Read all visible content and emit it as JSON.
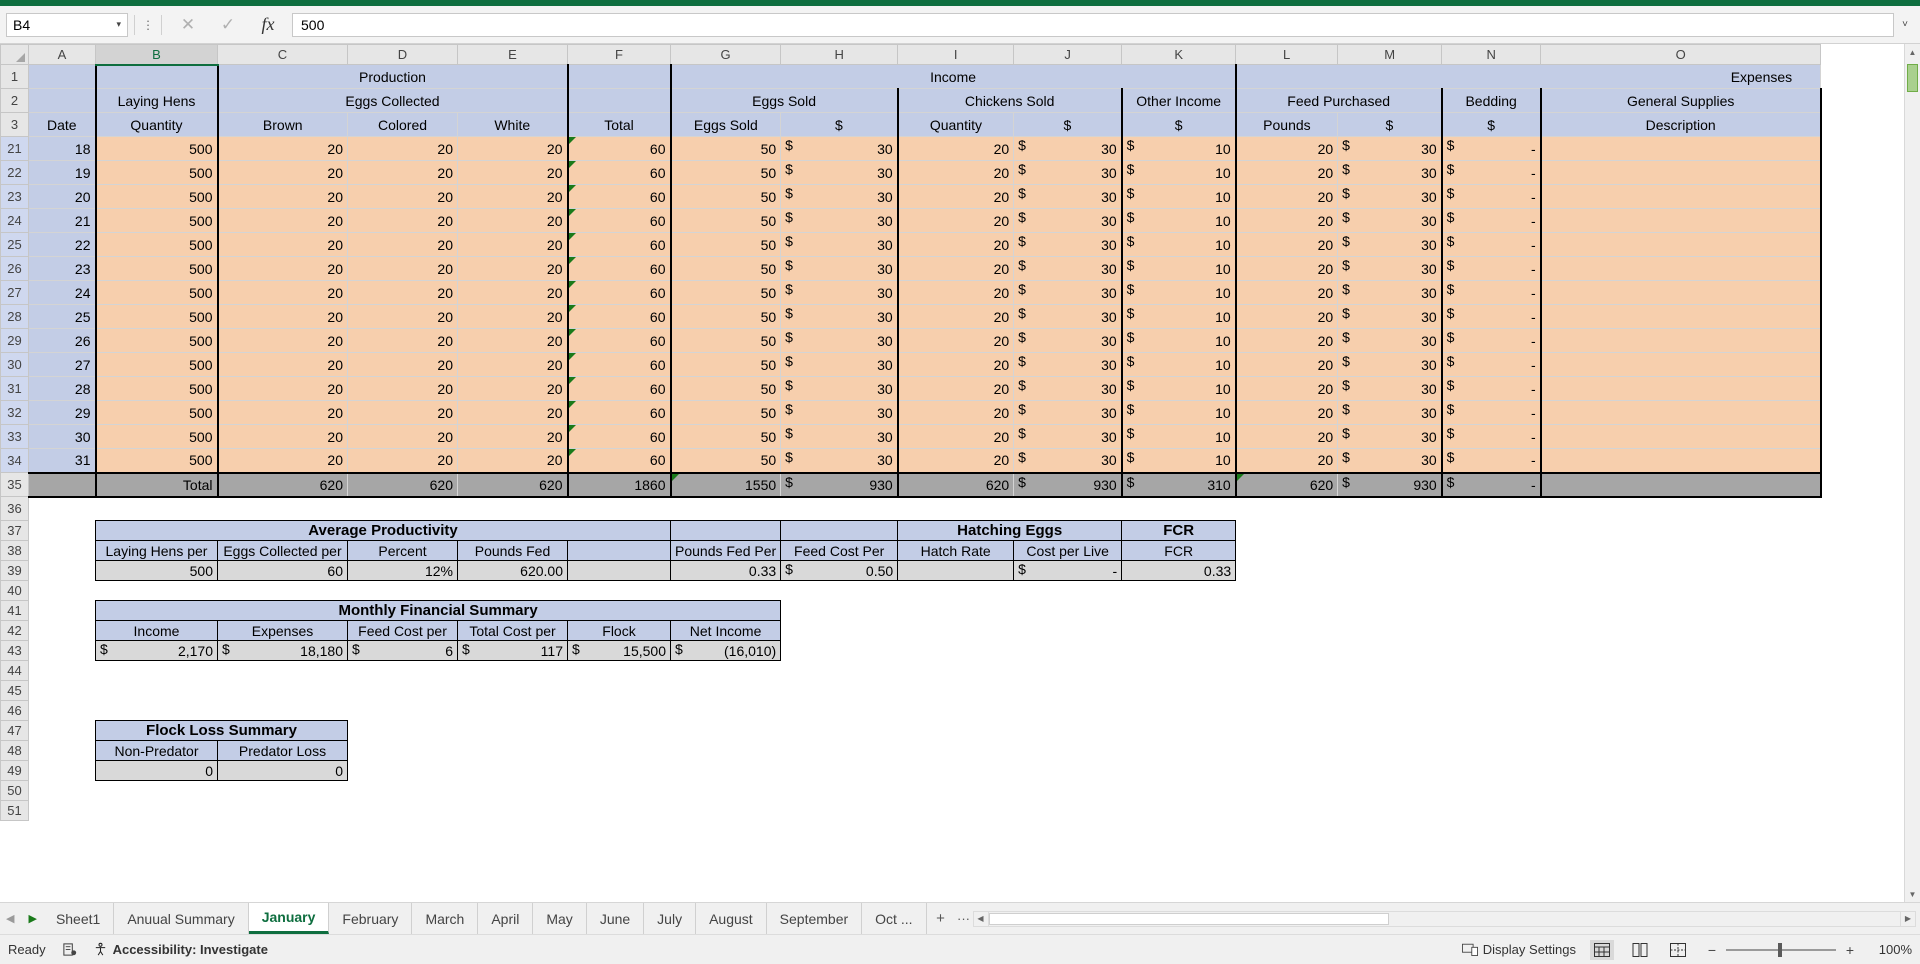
{
  "formula_bar": {
    "name_box": "B4",
    "name_box_caret": "▾",
    "cancel_icon": "✕",
    "enter_icon": "✓",
    "fx_icon": "fx",
    "formula_value": "500",
    "expand_icon": "˅"
  },
  "grid": {
    "selected_column": "B",
    "column_letters": [
      "A",
      "B",
      "C",
      "D",
      "E",
      "F",
      "G",
      "H",
      "I",
      "J",
      "K",
      "L",
      "M",
      "N",
      "O"
    ],
    "row_numbers": [
      "1",
      "2",
      "3",
      "21",
      "22",
      "23",
      "24",
      "25",
      "26",
      "27",
      "28",
      "29",
      "30",
      "31",
      "32",
      "33",
      "34",
      "35",
      "36",
      "37",
      "38",
      "39",
      "40",
      "41",
      "42",
      "43",
      "44",
      "45",
      "46",
      "47",
      "48",
      "49",
      "50",
      "51"
    ],
    "group_headers": {
      "production": "Production",
      "income": "Income",
      "expenses": "Expenses"
    },
    "sub_headers": {
      "laying_hens": "Laying Hens",
      "eggs_collected": "Eggs Collected",
      "eggs_sold": "Eggs Sold",
      "chickens_sold": "Chickens Sold",
      "other_income": "Other Income",
      "feed_purchased": "Feed Purchased",
      "bedding": "Bedding",
      "general_supplies": "General Supplies"
    },
    "field_headers": {
      "date": "Date",
      "quantity": "Quantity",
      "brown": "Brown",
      "colored": "Colored",
      "white": "White",
      "total": "Total",
      "eggs_sold": "Eggs Sold",
      "dollar": "$",
      "chicken_qty": "Quantity",
      "chicken_dollar": "$",
      "other_dollar": "$",
      "pounds": "Pounds",
      "feed_dollar": "$",
      "bedding_dollar": "$",
      "description": "Description"
    },
    "rows": [
      {
        "r": "21",
        "date": "18",
        "qty": "500",
        "brown": "20",
        "colored": "20",
        "white": "20",
        "total": "60",
        "eggs_sold": "50",
        "eggs_amt": "30",
        "chick_qty": "20",
        "chick_amt": "30",
        "other_amt": "10",
        "pounds": "20",
        "feed_amt": "30",
        "bedding_amt": "-",
        "desc": ""
      },
      {
        "r": "22",
        "date": "19",
        "qty": "500",
        "brown": "20",
        "colored": "20",
        "white": "20",
        "total": "60",
        "eggs_sold": "50",
        "eggs_amt": "30",
        "chick_qty": "20",
        "chick_amt": "30",
        "other_amt": "10",
        "pounds": "20",
        "feed_amt": "30",
        "bedding_amt": "-",
        "desc": ""
      },
      {
        "r": "23",
        "date": "20",
        "qty": "500",
        "brown": "20",
        "colored": "20",
        "white": "20",
        "total": "60",
        "eggs_sold": "50",
        "eggs_amt": "30",
        "chick_qty": "20",
        "chick_amt": "30",
        "other_amt": "10",
        "pounds": "20",
        "feed_amt": "30",
        "bedding_amt": "-",
        "desc": ""
      },
      {
        "r": "24",
        "date": "21",
        "qty": "500",
        "brown": "20",
        "colored": "20",
        "white": "20",
        "total": "60",
        "eggs_sold": "50",
        "eggs_amt": "30",
        "chick_qty": "20",
        "chick_amt": "30",
        "other_amt": "10",
        "pounds": "20",
        "feed_amt": "30",
        "bedding_amt": "-",
        "desc": ""
      },
      {
        "r": "25",
        "date": "22",
        "qty": "500",
        "brown": "20",
        "colored": "20",
        "white": "20",
        "total": "60",
        "eggs_sold": "50",
        "eggs_amt": "30",
        "chick_qty": "20",
        "chick_amt": "30",
        "other_amt": "10",
        "pounds": "20",
        "feed_amt": "30",
        "bedding_amt": "-",
        "desc": ""
      },
      {
        "r": "26",
        "date": "23",
        "qty": "500",
        "brown": "20",
        "colored": "20",
        "white": "20",
        "total": "60",
        "eggs_sold": "50",
        "eggs_amt": "30",
        "chick_qty": "20",
        "chick_amt": "30",
        "other_amt": "10",
        "pounds": "20",
        "feed_amt": "30",
        "bedding_amt": "-",
        "desc": ""
      },
      {
        "r": "27",
        "date": "24",
        "qty": "500",
        "brown": "20",
        "colored": "20",
        "white": "20",
        "total": "60",
        "eggs_sold": "50",
        "eggs_amt": "30",
        "chick_qty": "20",
        "chick_amt": "30",
        "other_amt": "10",
        "pounds": "20",
        "feed_amt": "30",
        "bedding_amt": "-",
        "desc": ""
      },
      {
        "r": "28",
        "date": "25",
        "qty": "500",
        "brown": "20",
        "colored": "20",
        "white": "20",
        "total": "60",
        "eggs_sold": "50",
        "eggs_amt": "30",
        "chick_qty": "20",
        "chick_amt": "30",
        "other_amt": "10",
        "pounds": "20",
        "feed_amt": "30",
        "bedding_amt": "-",
        "desc": ""
      },
      {
        "r": "29",
        "date": "26",
        "qty": "500",
        "brown": "20",
        "colored": "20",
        "white": "20",
        "total": "60",
        "eggs_sold": "50",
        "eggs_amt": "30",
        "chick_qty": "20",
        "chick_amt": "30",
        "other_amt": "10",
        "pounds": "20",
        "feed_amt": "30",
        "bedding_amt": "-",
        "desc": ""
      },
      {
        "r": "30",
        "date": "27",
        "qty": "500",
        "brown": "20",
        "colored": "20",
        "white": "20",
        "total": "60",
        "eggs_sold": "50",
        "eggs_amt": "30",
        "chick_qty": "20",
        "chick_amt": "30",
        "other_amt": "10",
        "pounds": "20",
        "feed_amt": "30",
        "bedding_amt": "-",
        "desc": ""
      },
      {
        "r": "31",
        "date": "28",
        "qty": "500",
        "brown": "20",
        "colored": "20",
        "white": "20",
        "total": "60",
        "eggs_sold": "50",
        "eggs_amt": "30",
        "chick_qty": "20",
        "chick_amt": "30",
        "other_amt": "10",
        "pounds": "20",
        "feed_amt": "30",
        "bedding_amt": "-",
        "desc": ""
      },
      {
        "r": "32",
        "date": "29",
        "qty": "500",
        "brown": "20",
        "colored": "20",
        "white": "20",
        "total": "60",
        "eggs_sold": "50",
        "eggs_amt": "30",
        "chick_qty": "20",
        "chick_amt": "30",
        "other_amt": "10",
        "pounds": "20",
        "feed_amt": "30",
        "bedding_amt": "-",
        "desc": ""
      },
      {
        "r": "33",
        "date": "30",
        "qty": "500",
        "brown": "20",
        "colored": "20",
        "white": "20",
        "total": "60",
        "eggs_sold": "50",
        "eggs_amt": "30",
        "chick_qty": "20",
        "chick_amt": "30",
        "other_amt": "10",
        "pounds": "20",
        "feed_amt": "30",
        "bedding_amt": "-",
        "desc": ""
      },
      {
        "r": "34",
        "date": "31",
        "qty": "500",
        "brown": "20",
        "colored": "20",
        "white": "20",
        "total": "60",
        "eggs_sold": "50",
        "eggs_amt": "30",
        "chick_qty": "20",
        "chick_amt": "30",
        "other_amt": "10",
        "pounds": "20",
        "feed_amt": "30",
        "bedding_amt": "-",
        "desc": ""
      }
    ],
    "total_row": {
      "r": "35",
      "label": "Total",
      "brown": "620",
      "colored": "620",
      "white": "620",
      "total": "1860",
      "eggs_sold": "1550",
      "eggs_amt": "930",
      "chick_qty": "620",
      "chick_amt": "930",
      "other_amt": "310",
      "pounds": "620",
      "feed_amt": "930",
      "bedding_amt": "-",
      "desc": ""
    }
  },
  "average_productivity": {
    "title": "Average Productivity",
    "hatching_title": "Hatching Eggs",
    "fcr_title": "FCR",
    "headers": [
      "Laying Hens per",
      "Eggs Collected per",
      "Percent",
      "Pounds Fed",
      "",
      "Pounds Fed Per",
      "Feed Cost Per",
      "Hatch Rate",
      "Cost per Live",
      "FCR"
    ],
    "values": [
      "500",
      "60",
      "12%",
      "620.00",
      "",
      "0.33",
      "0.50",
      "",
      "-",
      "0.33"
    ],
    "feed_cost_symbol": "$",
    "cost_per_live_symbol": "$"
  },
  "monthly_financial_summary": {
    "title": "Monthly Financial Summary",
    "headers": [
      "Income",
      "Expenses",
      "Feed Cost per",
      "Total Cost per",
      "Flock",
      "Net Income"
    ],
    "symbols": [
      "$",
      "$",
      "$",
      "$",
      "$",
      "$"
    ],
    "values": [
      "2,170",
      "18,180",
      "6",
      "117",
      "15,500",
      "(16,010)"
    ]
  },
  "flock_loss_summary": {
    "title": "Flock Loss Summary",
    "headers": [
      "Non-Predator",
      "Predator Loss"
    ],
    "values": [
      "0",
      "0"
    ]
  },
  "sheet_tabs": {
    "first_icon": "◀",
    "next_icon": "▶",
    "tabs": [
      {
        "label": "Sheet1",
        "active": false
      },
      {
        "label": "Anuual Summary",
        "active": false
      },
      {
        "label": "January",
        "active": true
      },
      {
        "label": "February",
        "active": false
      },
      {
        "label": "March",
        "active": false
      },
      {
        "label": "April",
        "active": false
      },
      {
        "label": "May",
        "active": false
      },
      {
        "label": "June",
        "active": false
      },
      {
        "label": "July",
        "active": false
      },
      {
        "label": "August",
        "active": false
      },
      {
        "label": "September",
        "active": false
      },
      {
        "label": "Oct ...",
        "active": false
      }
    ],
    "add_sheet_icon": "+",
    "more_icon": "⋮"
  },
  "status_bar": {
    "ready": "Ready",
    "accessibility": "Accessibility: Investigate",
    "display_settings": "Display Settings",
    "zoom_level": "100%",
    "zoom_minus": "−",
    "zoom_plus": "+"
  }
}
